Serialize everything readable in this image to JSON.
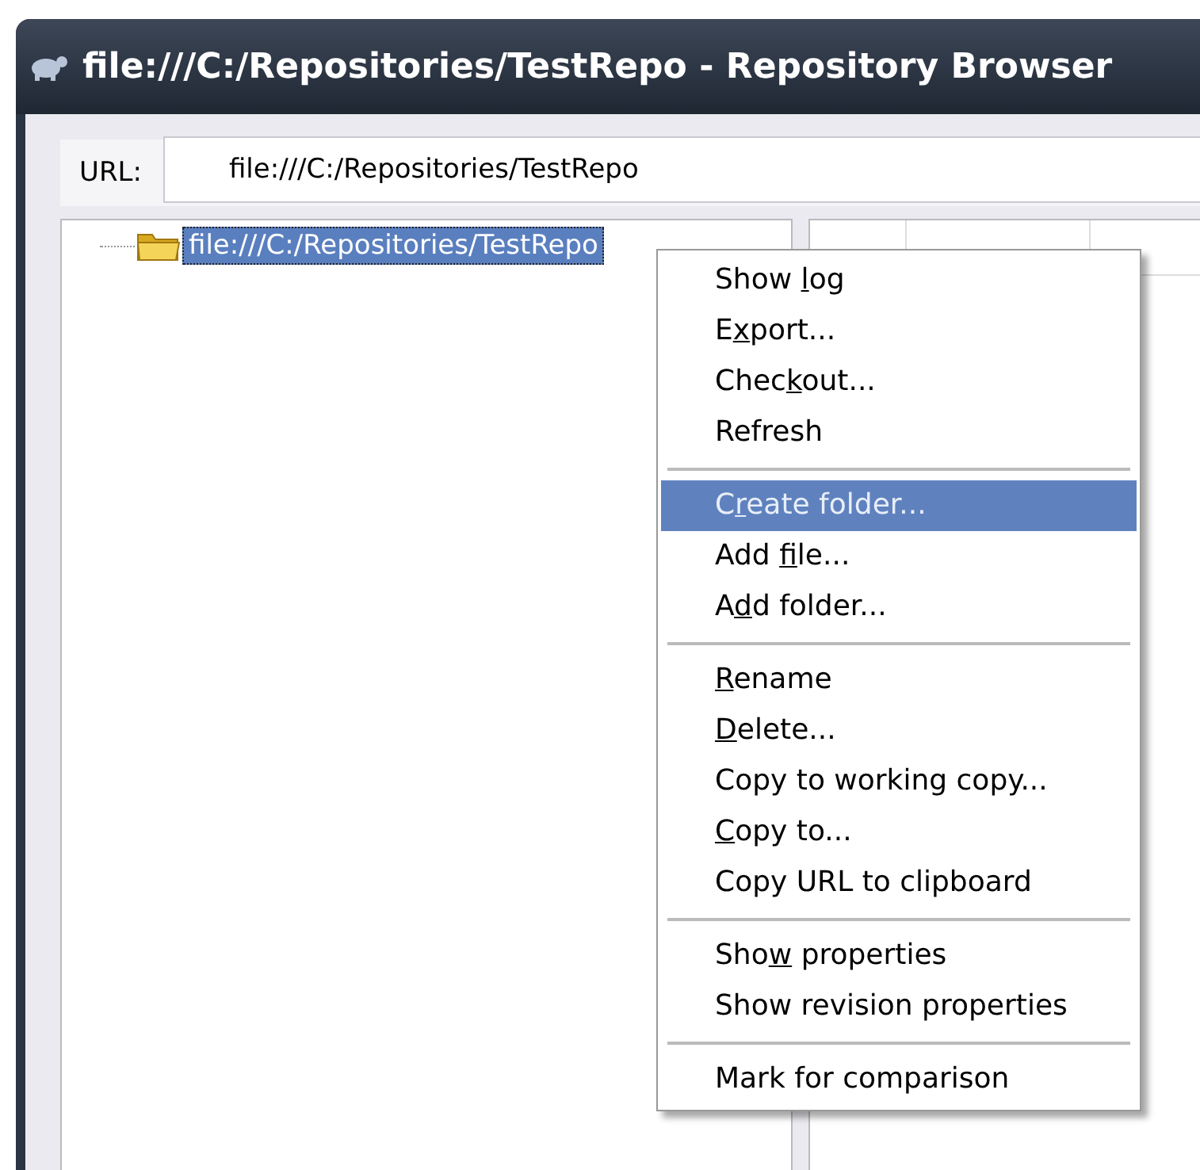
{
  "window": {
    "title": "file:///C:/Repositories/TestRepo - Repository Browser"
  },
  "url_bar": {
    "label": "URL:",
    "value": "file:///C:/Repositories/TestRepo"
  },
  "tree": {
    "items": [
      {
        "label": "file:///C:/Repositories/TestRepo",
        "selected": true
      }
    ]
  },
  "context_menu": {
    "groups": [
      [
        {
          "parts": [
            {
              "text": "Show ",
              "underlined": false
            },
            {
              "text": "l",
              "underlined": true
            },
            {
              "text": "og",
              "underlined": false
            }
          ],
          "highlighted": false
        },
        {
          "parts": [
            {
              "text": "E",
              "underlined": false
            },
            {
              "text": "x",
              "underlined": true
            },
            {
              "text": "port...",
              "underlined": false
            }
          ],
          "highlighted": false
        },
        {
          "parts": [
            {
              "text": "Chec",
              "underlined": false
            },
            {
              "text": "k",
              "underlined": true
            },
            {
              "text": "out...",
              "underlined": false
            }
          ],
          "highlighted": false
        },
        {
          "parts": [
            {
              "text": "Refresh",
              "underlined": false
            }
          ],
          "highlighted": false
        }
      ],
      [
        {
          "parts": [
            {
              "text": "C",
              "underlined": false
            },
            {
              "text": "r",
              "underlined": true
            },
            {
              "text": "eate folder...",
              "underlined": false
            }
          ],
          "highlighted": true
        },
        {
          "parts": [
            {
              "text": "Add ",
              "underlined": false
            },
            {
              "text": "f",
              "underlined": true
            },
            {
              "text": "ile...",
              "underlined": false
            }
          ],
          "highlighted": false
        },
        {
          "parts": [
            {
              "text": "A",
              "underlined": false
            },
            {
              "text": "d",
              "underlined": true
            },
            {
              "text": "d folder...",
              "underlined": false
            }
          ],
          "highlighted": false
        }
      ],
      [
        {
          "parts": [
            {
              "text": "R",
              "underlined": true
            },
            {
              "text": "ename",
              "underlined": false
            }
          ],
          "highlighted": false
        },
        {
          "parts": [
            {
              "text": "D",
              "underlined": true
            },
            {
              "text": "elete...",
              "underlined": false
            }
          ],
          "highlighted": false
        },
        {
          "parts": [
            {
              "text": "Copy to working copy...",
              "underlined": false
            }
          ],
          "highlighted": false
        },
        {
          "parts": [
            {
              "text": "C",
              "underlined": true
            },
            {
              "text": "opy to...",
              "underlined": false
            }
          ],
          "highlighted": false
        },
        {
          "parts": [
            {
              "text": "Copy URL to clipboard",
              "underlined": false
            }
          ],
          "highlighted": false
        }
      ],
      [
        {
          "parts": [
            {
              "text": "Sho",
              "underlined": false
            },
            {
              "text": "w",
              "underlined": true
            },
            {
              "text": " properties",
              "underlined": false
            }
          ],
          "highlighted": false
        },
        {
          "parts": [
            {
              "text": "Show revision properties",
              "underlined": false
            }
          ],
          "highlighted": false
        }
      ],
      [
        {
          "parts": [
            {
              "text": "Mark for comparison",
              "underlined": false
            }
          ],
          "highlighted": false
        }
      ]
    ]
  }
}
